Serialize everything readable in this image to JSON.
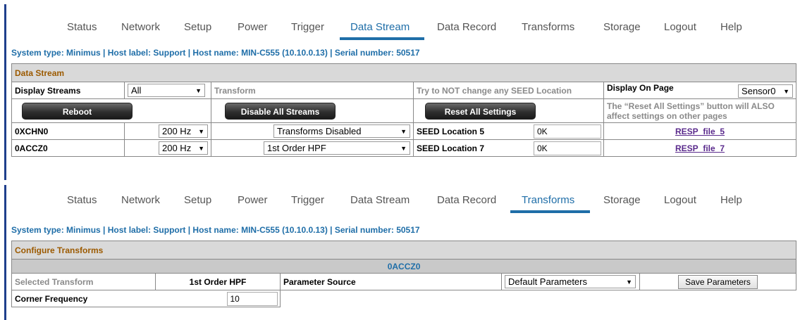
{
  "nav_top": {
    "items": [
      "Status",
      "Network",
      "Setup",
      "Power",
      "Trigger",
      "Data Stream",
      "Data Record",
      "Transforms",
      "Storage",
      "Logout",
      "Help"
    ],
    "active": "Data Stream"
  },
  "nav_bottom": {
    "items": [
      "Status",
      "Network",
      "Setup",
      "Power",
      "Trigger",
      "Data Stream",
      "Data Record",
      "Transforms",
      "Storage",
      "Logout",
      "Help"
    ],
    "active": "Transforms"
  },
  "system_line": "System type: Minimus | Host label: Support | Host name: MIN-C555 (10.10.0.13) | Serial number: 50517",
  "data_stream": {
    "title": "Data Stream",
    "display_streams_label": "Display Streams",
    "display_streams_value": "All",
    "transform_header": "Transform",
    "seed_note": "Try to NOT change any SEED Location",
    "display_on_page_label": "Display On Page",
    "display_on_page_value": "Sensor0",
    "reboot_label": "Reboot",
    "disable_all_label": "Disable All Streams",
    "reset_all_label": "Reset All Settings",
    "reset_note": "The “Reset All Settings” button will ALSO affect settings on other pages",
    "rows": [
      {
        "channel": "0XCHN0",
        "rate": "200 Hz",
        "transform": "Transforms Disabled",
        "seed_label": "SEED Location 5",
        "seed_value": "0K",
        "resp": "RESP_file_5"
      },
      {
        "channel": "0ACCZ0",
        "rate": "200 Hz",
        "transform": "1st Order HPF",
        "seed_label": "SEED Location 7",
        "seed_value": "0K",
        "resp": "RESP_file_7"
      }
    ]
  },
  "transforms": {
    "title": "Configure Transforms",
    "channel": "0ACCZ0",
    "selected_transform_label": "Selected Transform",
    "selected_transform_value": "1st Order HPF",
    "parameter_source_label": "Parameter Source",
    "parameter_source_value": "Default Parameters",
    "save_label": "Save Parameters",
    "corner_frequency_label": "Corner Frequency",
    "corner_frequency_value": "10"
  },
  "colors": {
    "accent_blue": "#1f6ea8",
    "title_brown": "#9c5a00",
    "link_purple": "#5a2a8c",
    "left_bar": "#1f3f8c"
  }
}
